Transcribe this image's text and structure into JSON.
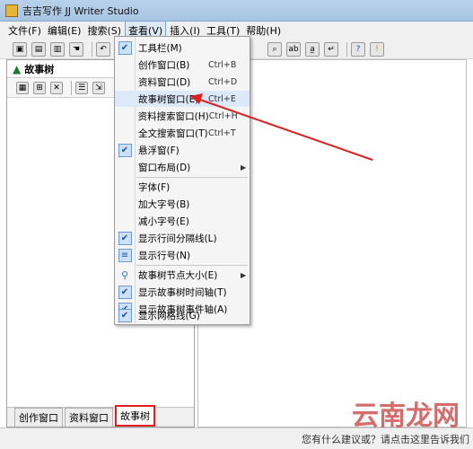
{
  "window": {
    "title": "吉吉写作 JJ Writer Studio"
  },
  "menubar": [
    {
      "label": "文件(F)"
    },
    {
      "label": "编辑(E)"
    },
    {
      "label": "搜索(S)"
    },
    {
      "label": "查看(V)"
    },
    {
      "label": "插入(I)"
    },
    {
      "label": "工具(T)"
    },
    {
      "label": "帮助(H)"
    }
  ],
  "left_panel": {
    "title": "故事树"
  },
  "bottom_tabs": [
    {
      "label": "创作窗口"
    },
    {
      "label": "资料窗口"
    },
    {
      "label": "故事树"
    }
  ],
  "view_menu": {
    "items": [
      {
        "label": "工具栏(M)",
        "checked": true,
        "shortcut": ""
      },
      {
        "label": "创作窗口(B)",
        "checked": false,
        "shortcut": "Ctrl+B"
      },
      {
        "label": "资料窗口(D)",
        "checked": false,
        "shortcut": "Ctrl+D"
      },
      {
        "label": "故事树窗口(E)",
        "checked": false,
        "shortcut": "Ctrl+E"
      },
      {
        "label": "资料搜索窗口(H)",
        "checked": false,
        "shortcut": "Ctrl+H"
      },
      {
        "label": "全文搜索窗口(T)",
        "checked": false,
        "shortcut": "Ctrl+T"
      },
      {
        "label": "悬浮窗(F)",
        "checked": true,
        "shortcut": ""
      },
      {
        "label": "窗口布局(D)",
        "checked": false,
        "shortcut": "",
        "submenu": true
      },
      {
        "label": "字体(F)",
        "checked": false,
        "shortcut": ""
      },
      {
        "label": "加大字号(B)",
        "checked": false,
        "shortcut": ""
      },
      {
        "label": "减小字号(E)",
        "checked": false,
        "shortcut": ""
      },
      {
        "label": "显示行间分隔线(L)",
        "checked": true,
        "shortcut": ""
      },
      {
        "label": "显示行号(N)",
        "checked": false,
        "shortcut": ""
      },
      {
        "label": "故事树节点大小(E)",
        "checked": false,
        "shortcut": "",
        "submenu": true
      },
      {
        "label": "显示故事树时间轴(T)",
        "checked": true,
        "shortcut": ""
      },
      {
        "label": "显示故事树事件轴(A)",
        "checked": true,
        "shortcut": ""
      },
      {
        "label": "显示网格线(G)",
        "checked": true,
        "shortcut": ""
      }
    ]
  },
  "statusbar": {
    "text": "您有什么建议或？请点击这里告诉我们"
  },
  "watermark": {
    "text": "云南龙网"
  },
  "colors": {
    "highlight_box": "#e02020",
    "arrow": "#e02020",
    "check_bg": "#cde0f7"
  }
}
